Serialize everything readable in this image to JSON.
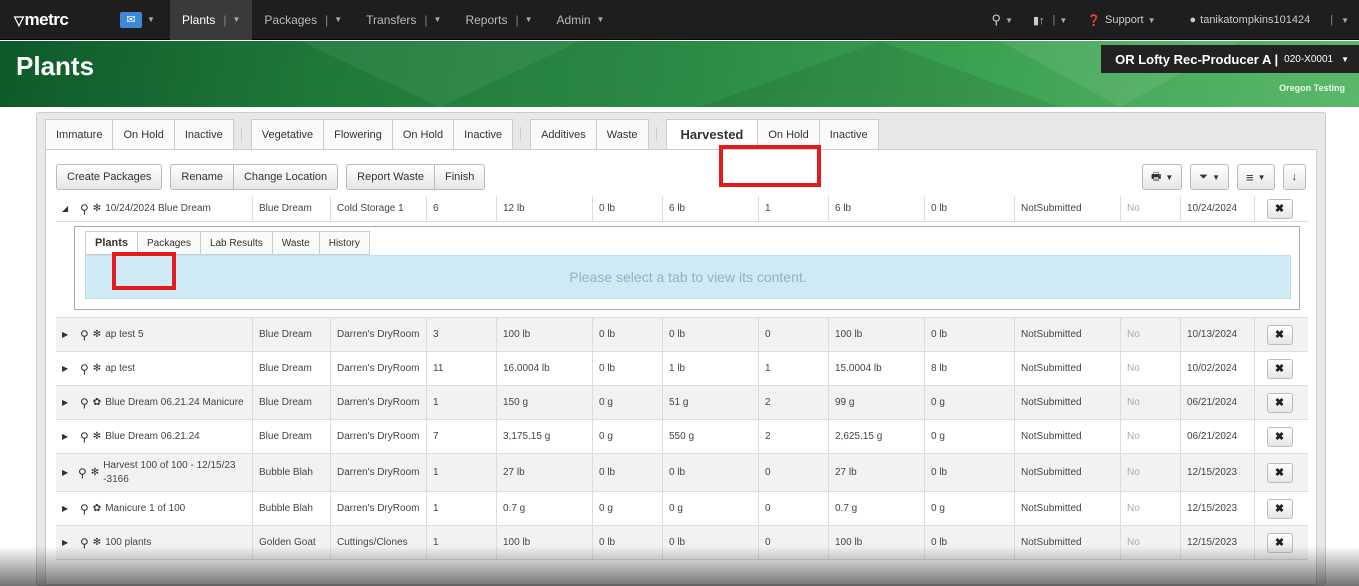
{
  "nav": {
    "logo": "metrc",
    "items": [
      {
        "label": "Plants",
        "active": true
      },
      {
        "label": "Packages"
      },
      {
        "label": "Transfers"
      },
      {
        "label": "Reports"
      },
      {
        "label": "Admin"
      }
    ],
    "support": "Support",
    "user": "tanikatompkins101424"
  },
  "header": {
    "title": "Plants",
    "facility": "OR Lofty Rec-Producer A |",
    "license": "020-X0001",
    "environment": "Oregon Testing"
  },
  "tabs": [
    "Immature",
    "On Hold",
    "Inactive",
    "Vegetative",
    "Flowering",
    "On Hold",
    "Inactive",
    "Additives",
    "Waste",
    "Harvested",
    "On Hold",
    "Inactive"
  ],
  "toolbar": {
    "create_packages": "Create Packages",
    "rename": "Rename",
    "change_location": "Change Location",
    "report_waste": "Report Waste",
    "finish": "Finish"
  },
  "subtabs": [
    "Plants",
    "Packages",
    "Lab Results",
    "Waste",
    "History"
  ],
  "subcontent_message": "Please select a tab to view its content.",
  "rows": [
    {
      "name": "10/24/2024 Blue Dream",
      "strain": "Blue Dream",
      "location": "Cold Storage 1",
      "plants": "6",
      "wet": "12 lb",
      "waste": "0 lb",
      "packaged": "6 lb",
      "pkgs": "1",
      "remaining": "6 lb",
      "restored": "0 lb",
      "status": "NotSubmitted",
      "onhold": "No",
      "date": "10/24/2024",
      "icon": "leaf"
    },
    {
      "name": "ap test 5",
      "strain": "Blue Dream",
      "location": "Darren's DryRoom",
      "plants": "3",
      "wet": "100 lb",
      "waste": "0 lb",
      "packaged": "0 lb",
      "pkgs": "0",
      "remaining": "100 lb",
      "restored": "0 lb",
      "status": "NotSubmitted",
      "onhold": "No",
      "date": "10/13/2024",
      "icon": "leaf"
    },
    {
      "name": "ap test",
      "strain": "Blue Dream",
      "location": "Darren's DryRoom",
      "plants": "11",
      "wet": "16.0004 lb",
      "waste": "0 lb",
      "packaged": "1 lb",
      "pkgs": "1",
      "remaining": "15.0004 lb",
      "restored": "8 lb",
      "status": "NotSubmitted",
      "onhold": "No",
      "date": "10/02/2024",
      "icon": "leaf"
    },
    {
      "name": "Blue Dream 06.21.24 Manicure",
      "strain": "Blue Dream",
      "location": "Darren's DryRoom",
      "plants": "1",
      "wet": "150 g",
      "waste": "0 g",
      "packaged": "51 g",
      "pkgs": "2",
      "remaining": "99 g",
      "restored": "0 g",
      "status": "NotSubmitted",
      "onhold": "No",
      "date": "06/21/2024",
      "icon": "gear"
    },
    {
      "name": "Blue Dream 06.21.24",
      "strain": "Blue Dream",
      "location": "Darren's DryRoom",
      "plants": "7",
      "wet": "3,175.15 g",
      "waste": "0 g",
      "packaged": "550 g",
      "pkgs": "2",
      "remaining": "2,625.15 g",
      "restored": "0 g",
      "status": "NotSubmitted",
      "onhold": "No",
      "date": "06/21/2024",
      "icon": "leaf"
    },
    {
      "name": "Harvest 100 of 100 - 12/15/23 -3166",
      "strain": "Bubble Blah",
      "location": "Darren's DryRoom",
      "plants": "1",
      "wet": "27 lb",
      "waste": "0 lb",
      "packaged": "0 lb",
      "pkgs": "0",
      "remaining": "27 lb",
      "restored": "0 lb",
      "status": "NotSubmitted",
      "onhold": "No",
      "date": "12/15/2023",
      "icon": "leaf"
    },
    {
      "name": "Manicure 1 of 100",
      "strain": "Bubble Blah",
      "location": "Darren's DryRoom",
      "plants": "1",
      "wet": "0.7 g",
      "waste": "0 g",
      "packaged": "0 g",
      "pkgs": "0",
      "remaining": "0.7 g",
      "restored": "0 g",
      "status": "NotSubmitted",
      "onhold": "No",
      "date": "12/15/2023",
      "icon": "gear"
    },
    {
      "name": "100 plants",
      "strain": "Golden Goat",
      "location": "Cuttings/Clones",
      "plants": "1",
      "wet": "100 lb",
      "waste": "0 lb",
      "packaged": "0 lb",
      "pkgs": "0",
      "remaining": "100 lb",
      "restored": "0 lb",
      "status": "NotSubmitted",
      "onhold": "No",
      "date": "12/15/2023",
      "icon": "leaf"
    }
  ],
  "colors": {
    "nav_bg": "#1e1e1e",
    "banner": "#2b8a45",
    "highlight": "#e21b1b",
    "info_bg": "#cfeaf5"
  }
}
